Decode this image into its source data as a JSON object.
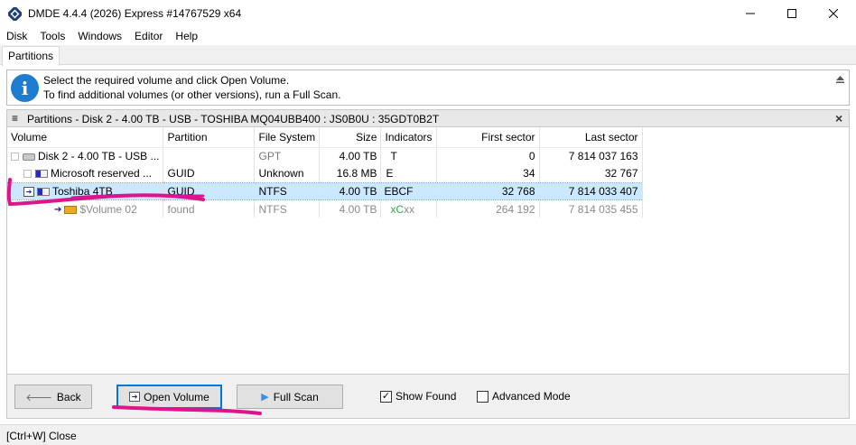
{
  "window": {
    "title": "DMDE 4.4.4 (2026) Express #14767529 x64"
  },
  "menu": [
    "Disk",
    "Tools",
    "Windows",
    "Editor",
    "Help"
  ],
  "tabs": [
    "Partitions"
  ],
  "info": {
    "line1": "Select the required volume and click Open Volume.",
    "line2": "To find additional volumes (or other versions), run a Full Scan."
  },
  "panel": {
    "title": "Partitions - Disk 2 - 4.00 TB - USB - TOSHIBA MQ04UBB400 : JS0B0U : 35GDT0B2T"
  },
  "table": {
    "columns": [
      "Volume",
      "Partition",
      "File System",
      "Size",
      "Indicators",
      "First sector",
      "Last sector"
    ],
    "rows": [
      {
        "volume": "Disk 2 - 4.00 TB - USB ...",
        "partition": "",
        "fs": "GPT",
        "size": "4.00 TB",
        "ind": "T",
        "first": "0",
        "last": "7 814 037 163"
      },
      {
        "volume": "Microsoft reserved ...",
        "partition": "GUID",
        "fs": "Unknown",
        "size": "16.8 MB",
        "ind": "E",
        "first": "34",
        "last": "32 767"
      },
      {
        "volume": "Toshiba 4TB",
        "partition": "GUID",
        "fs": "NTFS",
        "size": "4.00 TB",
        "ind": "EBCF",
        "first": "32 768",
        "last": "7 814 033 407"
      },
      {
        "volume": "$Volume 02",
        "partition": "found",
        "fs": "NTFS",
        "size": "4.00 TB",
        "ind_pre": "x",
        "ind_mid": "C",
        "ind_post": "xx",
        "first": "264 192",
        "last": "7 814 035 455"
      }
    ]
  },
  "buttons": {
    "back": "Back",
    "open": "Open Volume",
    "scan": "Full Scan"
  },
  "checkboxes": {
    "show_found": {
      "label": "Show Found",
      "checked": true
    },
    "advanced": {
      "label": "Advanced Mode",
      "checked": false
    }
  },
  "status": "[Ctrl+W] Close",
  "colors": {
    "selected_row": "#cce8ff",
    "indicator_green": "#28a745",
    "info_icon": "#1e7bd0",
    "annotation": "#e0138c"
  }
}
